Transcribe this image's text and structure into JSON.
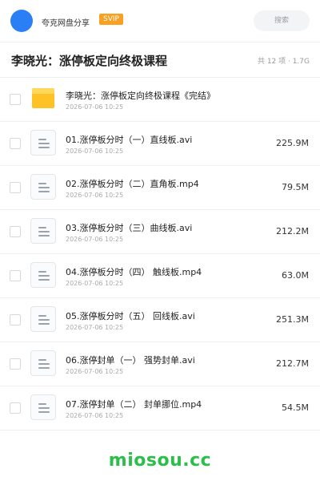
{
  "top_bar": {
    "app_name": "夸克网盘分享",
    "badge": "SVIP",
    "search_placeholder": "搜索"
  },
  "folder": {
    "title": "李晓光：涨停板定向终极课程",
    "summary": "共 12 项 · 1.7G"
  },
  "items": [
    {
      "type": "folder",
      "name": "李晓光：涨停板定向终极课程《完结》",
      "date": "2026-07-06 10:25",
      "size": ""
    },
    {
      "type": "file",
      "name": "01.涨停板分时（一）直线板.avi",
      "date": "2026-07-06 10:25",
      "size": "225.9M"
    },
    {
      "type": "file",
      "name": "02.涨停板分时（二）直角板.mp4",
      "date": "2026-07-06 10:25",
      "size": "79.5M"
    },
    {
      "type": "file",
      "name": "03.涨停板分时（三）曲线板.avi",
      "date": "2026-07-06 10:25",
      "size": "212.2M"
    },
    {
      "type": "file",
      "name": "04.涨停板分时（四） 触线板.mp4",
      "date": "2026-07-06 10:25",
      "size": "63.0M"
    },
    {
      "type": "file",
      "name": "05.涨停板分时（五） 回线板.avi",
      "date": "2026-07-06 10:25",
      "size": "251.3M"
    },
    {
      "type": "file",
      "name": "06.涨停封单（一） 强势封单.avi",
      "date": "2026-07-06 10:25",
      "size": "212.7M"
    },
    {
      "type": "file",
      "name": "07.涨停封单（二） 封单挪位.mp4",
      "date": "2026-07-06 10:25",
      "size": "54.5M"
    }
  ],
  "watermark": "miosou.cc",
  "colors": {
    "accent_blue": "#2b7ff6",
    "svip_orange": "#f7a021",
    "folder_yellow": "#ffc226",
    "watermark_green": "#2bbf4a"
  },
  "icons": {
    "folder": "folder-icon",
    "file": "document-icon"
  }
}
